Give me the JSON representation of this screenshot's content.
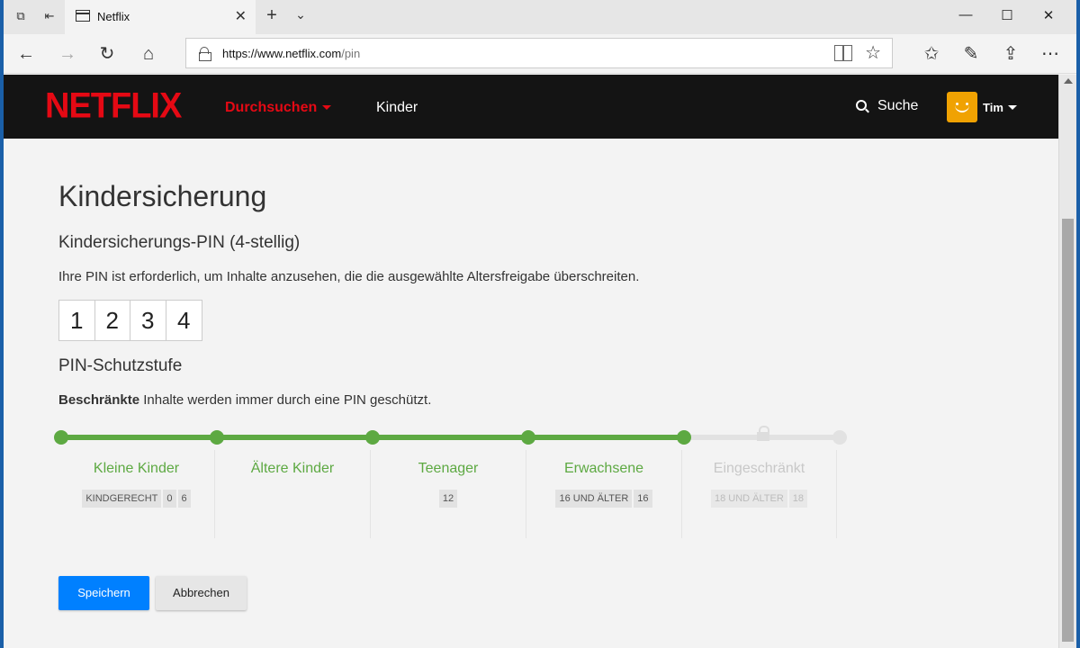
{
  "browser": {
    "tab_title": "Netflix",
    "url_host": "https://www.netflix.com",
    "url_path": "/pin"
  },
  "netflix": {
    "logo": "NETFLIX",
    "browse": "Durchsuchen",
    "kids": "Kinder",
    "search": "Suche",
    "user": "Tim"
  },
  "page": {
    "title": "Kindersicherung",
    "pin_heading": "Kindersicherungs-PIN (4-stellig)",
    "pin_description": "Ihre PIN ist erforderlich, um Inhalte anzusehen, die die ausgewählte Altersfreigabe überschreiten.",
    "pin_digits": [
      "1",
      "2",
      "3",
      "4"
    ],
    "protection_heading": "PIN-Schutzstufe",
    "protection_bold": "Beschränkte",
    "protection_rest": " Inhalte werden immer durch eine PIN geschützt.",
    "levels": [
      {
        "label": "Kleine Kinder",
        "badges": [
          "KINDGERECHT",
          "0",
          "6"
        ],
        "active": true
      },
      {
        "label": "Ältere Kinder",
        "badges": [],
        "active": true
      },
      {
        "label": "Teenager",
        "badges": [
          "12"
        ],
        "active": true
      },
      {
        "label": "Erwachsene",
        "badges": [
          "16 UND ÄLTER",
          "16"
        ],
        "active": true
      },
      {
        "label": "Eingeschränkt",
        "badges": [
          "18 UND ÄLTER",
          "18"
        ],
        "active": false
      }
    ],
    "save": "Speichern",
    "cancel": "Abbrechen"
  },
  "colors": {
    "netflix_red": "#e50914",
    "level_green": "#5da942",
    "primary_blue": "#0080ff"
  }
}
